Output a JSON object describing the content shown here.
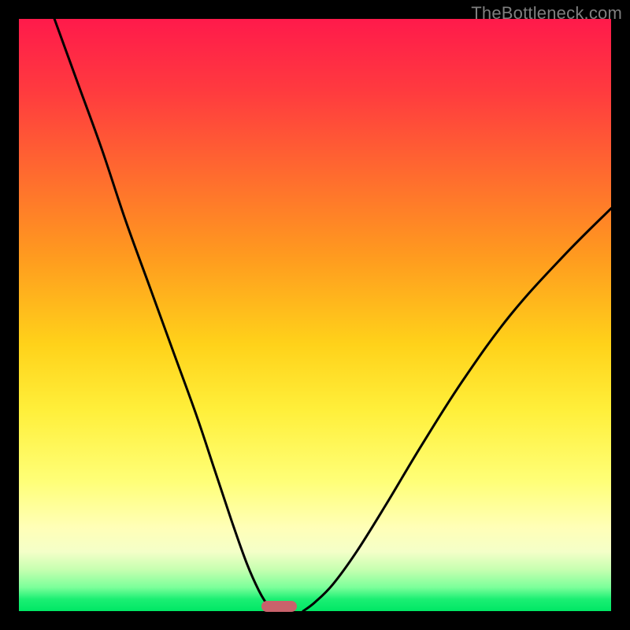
{
  "watermark": {
    "text": "TheBottleneck.com"
  },
  "colors": {
    "frame": "#000000",
    "curve": "#000000",
    "marker": "#c9626b",
    "watermark": "#7f7f7f",
    "gradient_top": "#ff1a4b",
    "gradient_bottom": "#00e765"
  },
  "chart_data": {
    "type": "line",
    "title": "",
    "xlabel": "",
    "ylabel": "",
    "xlim": [
      0,
      100
    ],
    "ylim": [
      0,
      100
    ],
    "grid": false,
    "legend": false,
    "series": [
      {
        "name": "left-curve",
        "x": [
          6,
          10,
          14,
          18,
          22,
          26,
          30,
          33,
          36,
          38.5,
          40.5,
          42,
          43
        ],
        "values": [
          100,
          89,
          78,
          66,
          55,
          44,
          33,
          24,
          15,
          8,
          3.5,
          1,
          0
        ]
      },
      {
        "name": "right-curve",
        "x": [
          48,
          50,
          53,
          57,
          62,
          68,
          75,
          83,
          92,
          100
        ],
        "values": [
          0,
          1.5,
          4.5,
          10,
          18,
          28,
          39,
          50,
          60,
          68
        ]
      }
    ],
    "marker": {
      "x_start": 41,
      "x_end": 47,
      "y": 0,
      "shape": "rounded-bar"
    },
    "background": "vertical heat gradient red→yellow→green"
  }
}
